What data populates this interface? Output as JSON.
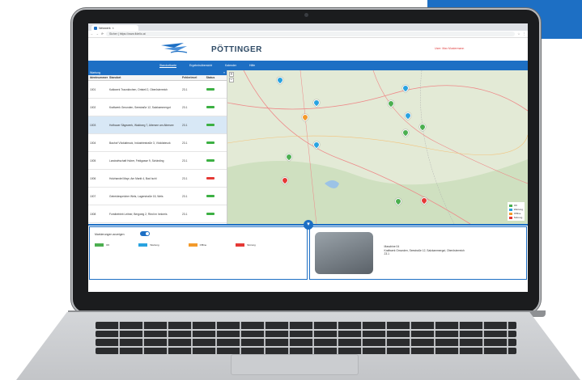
{
  "browser": {
    "tab_title": "Netzwerk",
    "url": "Sicher | https://www.fidelio.at"
  },
  "header": {
    "brand": "PÖTTINGER",
    "user": "User: Max Mustermann"
  },
  "nav": {
    "items": [
      "Standortkarte",
      "Ergebnisübersicht",
      "Kalender",
      "Hilfe"
    ]
  },
  "table": {
    "title": "Wartung",
    "columns": [
      "Identnummer",
      "Standort",
      "Fehlerlevel",
      "Status"
    ],
    "rows": [
      {
        "id": "1001",
        "location": "Kalkwerk Traunkirchen, Ortsteil 2, Oberösterreich",
        "level": "23.1",
        "status": "green"
      },
      {
        "id": "1002",
        "location": "Kraftwerk Gmunden, Seestraße 12, Salzkammergut",
        "level": "23.1",
        "status": "green"
      },
      {
        "id": "1003",
        "location": "Hofbauer Sägewerk, Waldweg 7, Attersee am Attersee",
        "level": "23.1",
        "status": "green",
        "selected": true
      },
      {
        "id": "1004",
        "location": "Bauhof Vöcklabruck, Industriestraße 3, Vöcklabruck",
        "level": "23.1",
        "status": "green"
      },
      {
        "id": "1005",
        "location": "Landwirtschaft Huber, Feldgasse 9, Schärding",
        "level": "23.1",
        "status": "green"
      },
      {
        "id": "1006",
        "location": "Holzhandel Mayr, Am Markt 4, Bad Ischl",
        "level": "23.1",
        "status": "red"
      },
      {
        "id": "1007",
        "location": "Getreidespeicher Wels, Lagerstraße 15, Wels",
        "level": "23.1",
        "status": "green"
      },
      {
        "id": "1008",
        "location": "Forstbetrieb Leitner, Bergweg 2, Ried im Innkreis",
        "level": "23.1",
        "status": "green"
      }
    ]
  },
  "map": {
    "legend": [
      {
        "label": "OK",
        "color": "#4caf50"
      },
      {
        "label": "Wartung",
        "color": "#29a3e0"
      },
      {
        "label": "Offline",
        "color": "#f39a2b"
      },
      {
        "label": "Störung",
        "color": "#e53935"
      }
    ],
    "zoom_in": "+",
    "zoom_out": "−"
  },
  "bottom": {
    "toggle_label": "Markierungen anzeigen",
    "chips": [
      {
        "label": "OK",
        "color": "#4caf50"
      },
      {
        "label": "Wartung",
        "color": "#29a3e0"
      },
      {
        "label": "Offline",
        "color": "#f39a2b"
      },
      {
        "label": "Störung",
        "color": "#e53935"
      }
    ],
    "filter_icon": "filter-icon",
    "machine_info": {
      "id": "Maschine 04",
      "location": "Kraftwerk Gmunden, Seestraße 12, Salzkammergut, Oberösterreich",
      "level": "23.1"
    }
  }
}
